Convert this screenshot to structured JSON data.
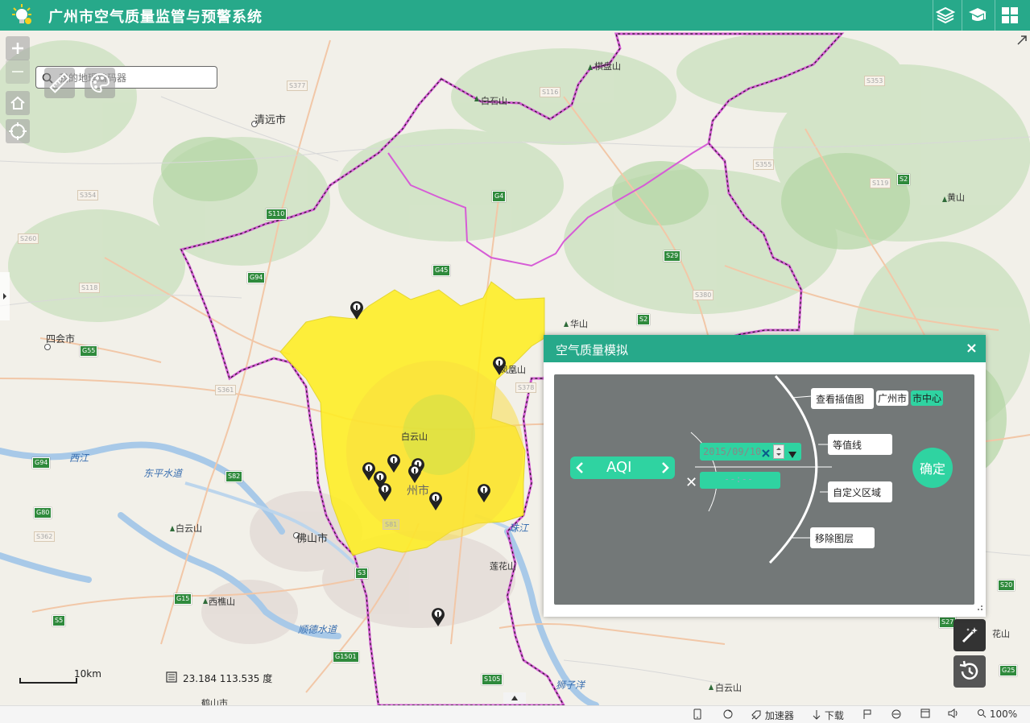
{
  "header": {
    "title": "广州市空气质量监管与预警系统",
    "icons": [
      "bulb-logo-icon",
      "layers-icon",
      "graduation-cap-icon",
      "grid-apps-icon"
    ]
  },
  "search": {
    "placeholder": "我的地理编码器"
  },
  "map": {
    "labels": {
      "qingyuan": "清远市",
      "sihui": "四会市",
      "foshan": "佛山市",
      "guangzhou": "州市",
      "xijiang": "西江",
      "dongping": "东平水道",
      "shunde": "顺德水道",
      "zhujiang": "珠江",
      "shiziyang": "狮子洋",
      "baiyunshan_n": "白云山",
      "baiyunshan_c": "白云山",
      "baiyunshan_w": "白云山",
      "baiyunshan_s": "白云山",
      "baishishan": "白石山",
      "qipanshan": "棋盘山",
      "huangshan": "黄山",
      "huashan": "华山",
      "fengshan": "凤凰山",
      "lianhuashan": "莲花山",
      "xiqiaoshan": "西樵山",
      "huashan_e": "花山",
      "heshanshi": "鹤山市"
    },
    "shields": {
      "s377": "S377",
      "s354": "S354",
      "s260": "S260",
      "s118": "S118",
      "s110": "S110",
      "g94": "G94",
      "g4": "G4",
      "g45": "G45",
      "s2": "S2",
      "s29": "S29",
      "s119": "S119",
      "s353": "S353",
      "s355": "S355",
      "s380": "S380",
      "s2b": "S2",
      "g55": "G55",
      "s361": "S361",
      "g94b": "G94",
      "s82": "S82",
      "g80": "G80",
      "s362": "S362",
      "g15": "G15",
      "s5": "S5",
      "s81": "S81",
      "s3": "S3",
      "g1501": "G1501",
      "s105": "S105",
      "s20": "S20",
      "s27": "S27",
      "g25": "G25",
      "s378": "S378",
      "s116": "S116"
    }
  },
  "scale": {
    "label": "10km"
  },
  "coords": {
    "text": "23.184  113.535 度"
  },
  "panel": {
    "title": "空气质量模拟",
    "close": "×",
    "aqi_label": "AQI",
    "date_value": "2015/09/10",
    "time_value": "--:--",
    "options": {
      "interp": "查看插值图",
      "city": "广州市",
      "center": "市中心",
      "contour": "等值线",
      "custom": "自定义区域",
      "remove": "移除图层"
    },
    "confirm": "确定",
    "x_mark": "✕"
  },
  "statusbar": {
    "accelerator": "加速器",
    "download": "下载",
    "zoom": "100%"
  },
  "colors": {
    "accent": "#27a98a",
    "mint": "#2fd3a1",
    "boundary": "#d65cd6",
    "pollution_yellow": "#ffee22"
  }
}
